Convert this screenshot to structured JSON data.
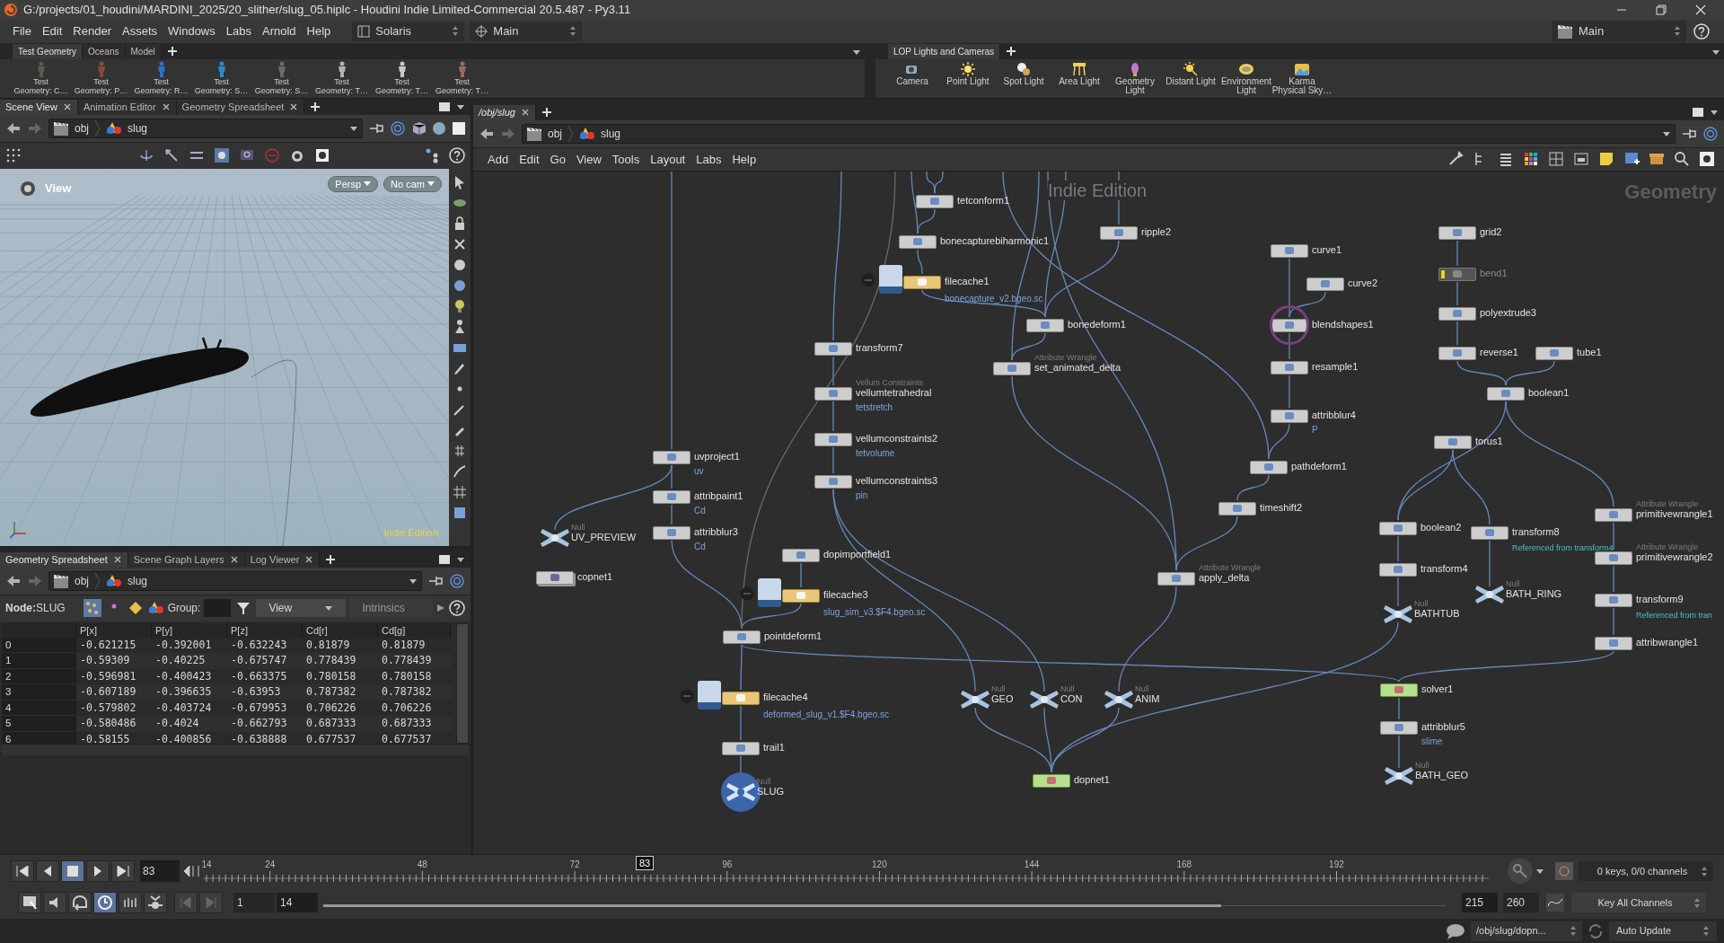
{
  "window": {
    "title": "G:/projects/01_houdini/MARDINI_2025/20_slither/slug_05.hiplc - Houdini Indie Limited-Commercial 20.5.487 - Py3.11"
  },
  "menu": [
    "File",
    "Edit",
    "Render",
    "Assets",
    "Windows",
    "Labs",
    "Arnold",
    "Help"
  ],
  "desktop": "Solaris",
  "context": "Main",
  "right_desktop": "Main",
  "shelf_left": {
    "tabs": [
      {
        "label": "Test Geometry",
        "selected": true
      },
      {
        "label": "Oceans",
        "selected": false
      },
      {
        "label": "Model",
        "selected": false
      }
    ],
    "tools": [
      {
        "lines": [
          "Test",
          "Geometry: C…"
        ]
      },
      {
        "lines": [
          "Test",
          "Geometry: P…"
        ]
      },
      {
        "lines": [
          "Test",
          "Geometry: R…"
        ]
      },
      {
        "lines": [
          "Test",
          "Geometry: S…"
        ]
      },
      {
        "lines": [
          "Test",
          "Geometry: S…"
        ]
      },
      {
        "lines": [
          "Test",
          "Geometry: T…"
        ]
      },
      {
        "lines": [
          "Test",
          "Geometry: T…"
        ]
      },
      {
        "lines": [
          "Test",
          "Geometry: T…"
        ]
      }
    ]
  },
  "shelf_right": {
    "tabs": [
      {
        "label": "LOP Lights and Cameras",
        "selected": true
      }
    ],
    "tools": [
      {
        "lines": [
          "Camera"
        ]
      },
      {
        "lines": [
          "Point Light"
        ]
      },
      {
        "lines": [
          "Spot Light"
        ]
      },
      {
        "lines": [
          "Area Light"
        ]
      },
      {
        "lines": [
          "Geometry",
          "Light"
        ]
      },
      {
        "lines": [
          "Distant Light"
        ]
      },
      {
        "lines": [
          "Environment",
          "Light"
        ]
      },
      {
        "lines": [
          "Karma",
          "Physical Sky…"
        ]
      }
    ]
  },
  "scene_pane": {
    "tabs": [
      {
        "label": "Scene View",
        "selected": true
      },
      {
        "label": "Animation Editor",
        "selected": false
      },
      {
        "label": "Geometry Spreadsheet",
        "selected": false
      }
    ],
    "path": [
      "obj",
      "slug"
    ],
    "viewport": {
      "title": "View",
      "camera_buttons": [
        "Persp",
        "No cam"
      ],
      "watermark": "Indie Edition"
    }
  },
  "spreadsheet_pane": {
    "tabs": [
      {
        "label": "Geometry Spreadsheet",
        "selected": true
      },
      {
        "label": "Scene Graph Layers",
        "selected": false
      },
      {
        "label": "Log Viewer",
        "selected": false
      }
    ],
    "path": [
      "obj",
      "slug"
    ],
    "node_label": "Node:",
    "node": "SLUG",
    "group_label": "Group:",
    "view": "View",
    "intrinsics": "Intrinsics",
    "columns": [
      "",
      "P[x]",
      "P[y]",
      "P[z]",
      "Cd[r]",
      "Cd[g]"
    ],
    "rows": [
      [
        "0",
        "-0.621215",
        "-0.392001",
        "-0.632243",
        "0.81879",
        "0.81879"
      ],
      [
        "1",
        "-0.59309",
        "-0.40225",
        "-0.675747",
        "0.778439",
        "0.778439"
      ],
      [
        "2",
        "-0.596981",
        "-0.400423",
        "-0.663375",
        "0.780158",
        "0.780158"
      ],
      [
        "3",
        "-0.607189",
        "-0.396635",
        "-0.63953",
        "0.787382",
        "0.787382"
      ],
      [
        "4",
        "-0.579802",
        "-0.403724",
        "-0.679953",
        "0.706226",
        "0.706226"
      ],
      [
        "5",
        "-0.580486",
        "-0.4024",
        "-0.662793",
        "0.687333",
        "0.687333"
      ],
      [
        "6",
        "-0.58155",
        "-0.400856",
        "-0.638888",
        "0.677537",
        "0.677537"
      ]
    ]
  },
  "network_pane": {
    "tabs": [
      {
        "label": "/obj/slug",
        "selected": true
      }
    ],
    "path": [
      "obj",
      "slug"
    ],
    "menu": [
      "Add",
      "Edit",
      "Go",
      "View",
      "Tools",
      "Layout",
      "Labs",
      "Help"
    ],
    "watermark": "Indie Edition",
    "context_label": "Geometry",
    "nodes": [
      {
        "name": "tetconform1",
        "kind": "sop",
        "current": false,
        "display": false
      },
      {
        "name": "bonecapturebiharmonic1",
        "kind": "sop",
        "current": false,
        "display": false
      },
      {
        "name": "filecache1",
        "kind": "filecache",
        "note": "bonecapture_v2.bgeo.sc",
        "current": false,
        "display": false
      },
      {
        "name": "ripple2",
        "kind": "sop",
        "current": false,
        "display": false
      },
      {
        "name": "bonedeform1",
        "kind": "sop",
        "current": false,
        "display": false
      },
      {
        "name": "transform7",
        "kind": "sop",
        "current": false,
        "display": false
      },
      {
        "name": "set_animated_delta",
        "kind": "sop",
        "subtitle": "Attribute Wrangle",
        "current": false,
        "display": false
      },
      {
        "name": "vellumtetrahedral",
        "kind": "sop",
        "subtitle": "Vellum Constraints",
        "note": "tetstretch",
        "current": false,
        "display": false
      },
      {
        "name": "vellumconstraints2",
        "kind": "sop",
        "note": "tetvolume",
        "current": false,
        "display": false
      },
      {
        "name": "vellumconstraints3",
        "kind": "sop",
        "note": "pin",
        "current": false,
        "display": false
      },
      {
        "name": "uvproject1",
        "kind": "sop",
        "note": "uv",
        "current": false,
        "display": false
      },
      {
        "name": "attribpaint1",
        "kind": "sop",
        "note": "Cd",
        "current": false,
        "display": false
      },
      {
        "name": "attribblur3",
        "kind": "sop",
        "note": "Cd",
        "current": false,
        "display": false
      },
      {
        "name": "UV_PREVIEW",
        "kind": "null",
        "subtitle": "Null",
        "current": false,
        "display": false
      },
      {
        "name": "copnet1",
        "kind": "subnet",
        "current": false,
        "display": false
      },
      {
        "name": "dopimportfield1",
        "kind": "sop",
        "current": false,
        "display": false
      },
      {
        "name": "filecache3",
        "kind": "filecache",
        "note": "slug_sim_v3.$F4.bgeo.sc",
        "current": false,
        "display": false
      },
      {
        "name": "pointdeform1",
        "kind": "sop",
        "current": false,
        "display": false
      },
      {
        "name": "filecache4",
        "kind": "filecache",
        "note": "deformed_slug_v1.$F4.bgeo.sc",
        "current": false,
        "display": false
      },
      {
        "name": "trail1",
        "kind": "sop",
        "current": false,
        "display": false
      },
      {
        "name": "SLUG",
        "kind": "null",
        "subtitle": "Null",
        "current": false,
        "display": true
      },
      {
        "name": "curve1",
        "kind": "sop",
        "current": false,
        "display": false
      },
      {
        "name": "curve2",
        "kind": "sop",
        "current": false,
        "display": false
      },
      {
        "name": "blendshapes1",
        "kind": "sop",
        "current": true,
        "display": false
      },
      {
        "name": "resample1",
        "kind": "sop",
        "current": false,
        "display": false
      },
      {
        "name": "attribblur4",
        "kind": "sop",
        "note": "P",
        "current": false,
        "display": false
      },
      {
        "name": "pathdeform1",
        "kind": "sop",
        "current": false,
        "display": false
      },
      {
        "name": "timeshift2",
        "kind": "sop",
        "current": false,
        "display": false
      },
      {
        "name": "apply_delta",
        "kind": "sop",
        "subtitle": "Attribute Wrangle",
        "current": false,
        "display": false
      },
      {
        "name": "GEO",
        "kind": "null",
        "subtitle": "Null",
        "current": false,
        "display": false
      },
      {
        "name": "CON",
        "kind": "null",
        "subtitle": "Null",
        "current": false,
        "display": false
      },
      {
        "name": "ANIM",
        "kind": "null",
        "subtitle": "Null",
        "current": false,
        "display": false
      },
      {
        "name": "dopnet1",
        "kind": "dop",
        "current": false,
        "display": false
      },
      {
        "name": "grid2",
        "kind": "sop",
        "current": false,
        "display": false
      },
      {
        "name": "bend1",
        "kind": "bypassed",
        "current": false,
        "display": false
      },
      {
        "name": "polyextrude3",
        "kind": "sop",
        "current": false,
        "display": false
      },
      {
        "name": "reverse1",
        "kind": "sop",
        "current": false,
        "display": false
      },
      {
        "name": "tube1",
        "kind": "sop",
        "current": false,
        "display": false
      },
      {
        "name": "boolean1",
        "kind": "sop",
        "current": false,
        "display": false
      },
      {
        "name": "torus1",
        "kind": "sop",
        "current": false,
        "display": false
      },
      {
        "name": "boolean2",
        "kind": "sop",
        "current": false,
        "display": false
      },
      {
        "name": "transform8",
        "kind": "sop",
        "comment": "Referenced from transform4",
        "current": false,
        "display": false
      },
      {
        "name": "transform4",
        "kind": "sop",
        "current": false,
        "display": false
      },
      {
        "name": "BATH_RING",
        "kind": "null",
        "subtitle": "Null",
        "current": false,
        "display": false
      },
      {
        "name": "BATHTUB",
        "kind": "null",
        "subtitle": "Null",
        "current": false,
        "display": false
      },
      {
        "name": "primitivewrangle1",
        "kind": "sop",
        "subtitle": "Attribute Wrangle",
        "current": false,
        "display": false
      },
      {
        "name": "primitivewrangle2",
        "kind": "sop",
        "subtitle": "Attribute Wrangle",
        "current": false,
        "display": false
      },
      {
        "name": "transform9",
        "kind": "sop",
        "comment": "Referenced from tran",
        "current": false,
        "display": false
      },
      {
        "name": "attribwrangle1",
        "kind": "sop",
        "current": false,
        "display": false
      },
      {
        "name": "solver1",
        "kind": "dop",
        "current": false,
        "display": false
      },
      {
        "name": "attribblur5",
        "kind": "sop",
        "note": "slime",
        "current": false,
        "display": false
      },
      {
        "name": "BATH_GEO",
        "kind": "null",
        "subtitle": "Null",
        "current": false,
        "display": false
      }
    ]
  },
  "playbar": {
    "frame": "83",
    "ticks": [
      "14",
      "24",
      "48",
      "72",
      "96",
      "120",
      "144",
      "168",
      "192"
    ],
    "marker": "83",
    "start": "1",
    "range_start": "14",
    "range_end": "215",
    "end": "260",
    "range_bar": {
      "level": 0.8
    },
    "keys": "0 keys, 0/0 channels",
    "key_mode": "Key All Channels"
  },
  "status_bar": {
    "path": "/obj/slug/dopn...",
    "update_mode": "Auto Update"
  }
}
